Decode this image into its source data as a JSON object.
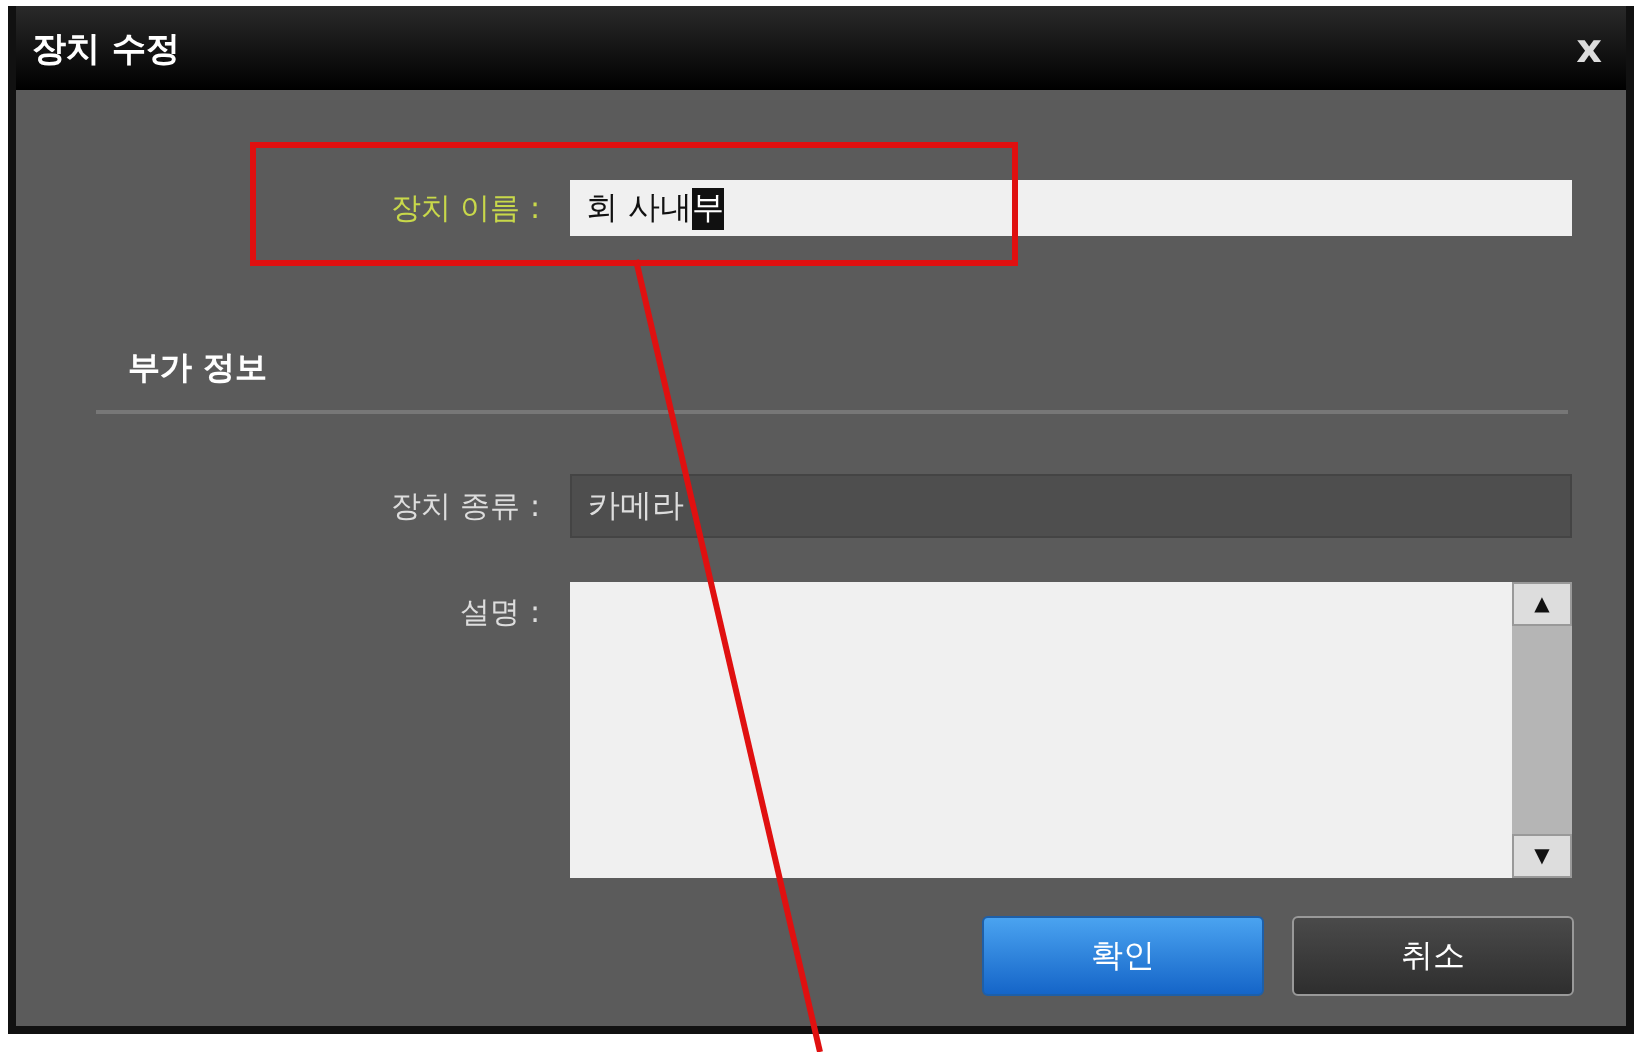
{
  "window": {
    "title": "장치 수정",
    "close": "x"
  },
  "name_field": {
    "label": "장치 이름 :",
    "value": "회 사내",
    "composing": "부",
    "highlighted": true
  },
  "section": {
    "title": "부가 정보"
  },
  "type_field": {
    "label": "장치 종류 :",
    "value": "카메라",
    "disabled": true
  },
  "description_field": {
    "label": "설명 :",
    "up": "▲",
    "down": "▼"
  },
  "buttons": [
    {
      "label": "확인",
      "kind": "primary"
    },
    {
      "label": "취소",
      "kind": "secondary"
    }
  ],
  "annotation": {
    "kind": "callout"
  }
}
